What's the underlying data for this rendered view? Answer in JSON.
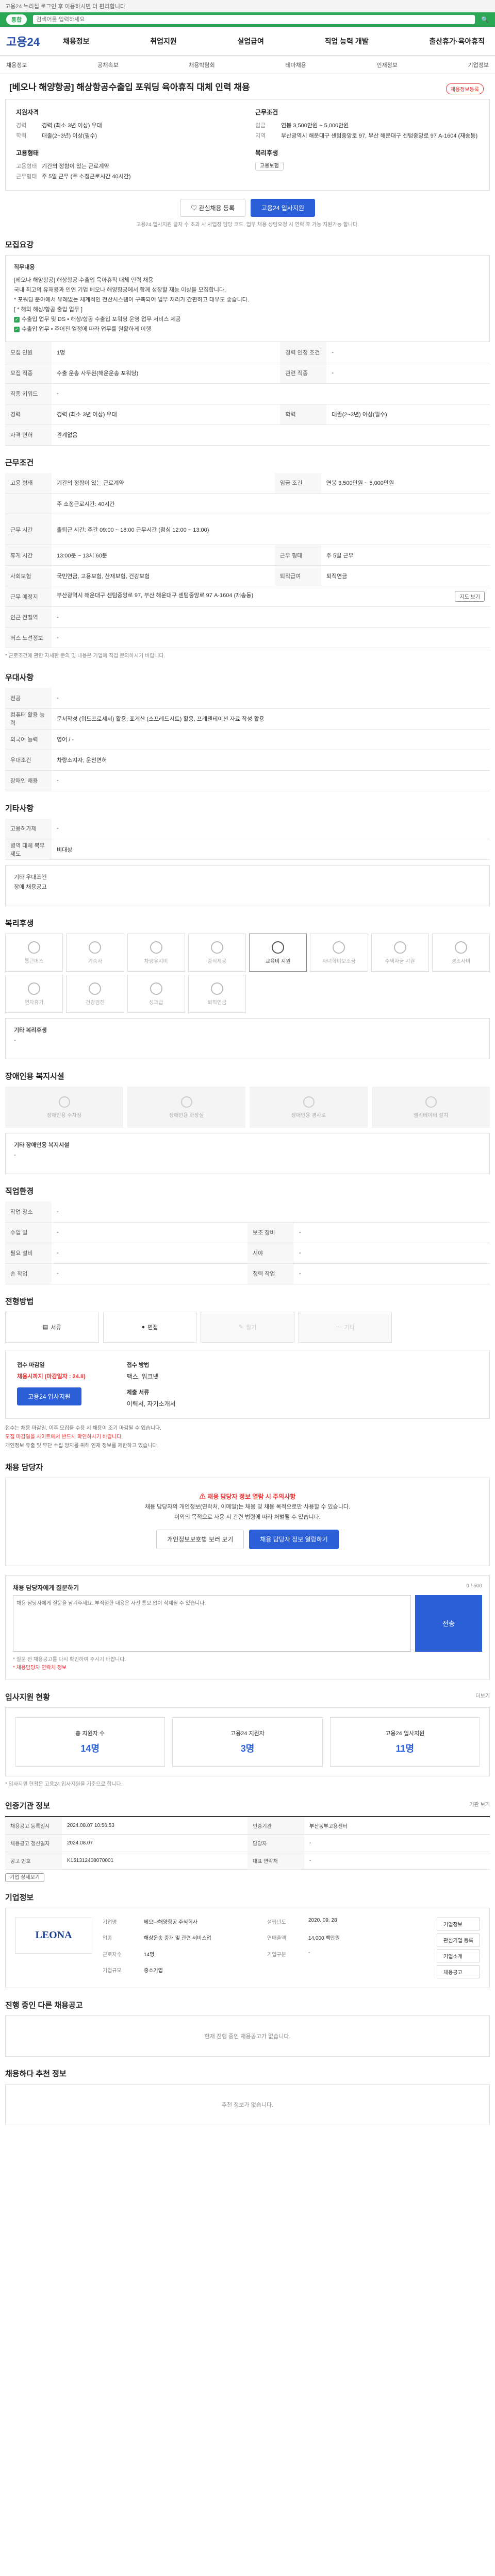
{
  "top": {
    "text": "고용24 누리집 로그인 후 이용하시면 더 편리합니다."
  },
  "search": {
    "pill": "통합",
    "placeholder": "검색어를 입력하세요"
  },
  "gnb": {
    "logo": "고용24",
    "menu": [
      "채용정보",
      "취업지원",
      "실업급여",
      "직업 능력 개발",
      "출산휴가·육아휴직"
    ]
  },
  "subnav": [
    "채용정보",
    "공채속보",
    "채용박람회",
    "테마채용",
    "인재정보",
    "기업정보"
  ],
  "job": {
    "title": "[베오나 해양항공] 해상항공수출입 포워딩 육아휴직 대체 인력 채용",
    "bookmark": "채용정보등록",
    "summary_left_title": "지원자격",
    "summary_right_title": "근무조건",
    "left": [
      {
        "k": "경력",
        "v": "경력 (최소 3년 이상) 우대"
      },
      {
        "k": "학력",
        "v": "대졸(2~3년) 이상(필수)"
      }
    ],
    "right": [
      {
        "k": "임금",
        "v": "연봉 3,500만원 ~ 5,000만원"
      },
      {
        "k": "지역",
        "v": "부산광역시 해운대구 센텀중앙로 97, 부산 해운대구 센텀중앙로 97 A-1604 (재송동)"
      }
    ],
    "type_title": "고용형태",
    "welfare_title": "복리후생",
    "type": [
      {
        "k": "고용형태",
        "v": "기간의 정함이 있는 근로계약"
      },
      {
        "k": "근무형태",
        "v": "주 5일 근무 (주 소정근로시간 40시간)"
      }
    ],
    "welfare_tag": "고용보험",
    "btn_save": "관심채용 등록",
    "btn_apply": "고용24 입사지원",
    "note": "고용24 입사지원 글자 수 초과 시 사업장 담당 코드. 업무 채용 상담요청 시 연락 후 가능 지원가능 합니다."
  },
  "s1": {
    "title": "모집요강",
    "duty_title": "직무내용",
    "duty": [
      "[베오나 해양항공] 해상항공 수출입 육아휴직 대체 인력 채용",
      "국내 최고의 유재용과 인연 기업 베오나 해양항공에서 함께 성장할 재능 이상을 모집합니다.",
      "* 포워딩 분야에서 유례없는 체계적인 전산시스템이 구축되어 업무 처리가 간편하고 대우도 좋습니다.",
      "[ * 해외 해상/항공 출입 업무 ]"
    ],
    "checks": [
      "수출입 업무 및 DS • 해상/항공 수출입 포워딩 운영 업무 서비스 제공",
      "수출입 업무 • 주어진 일정에 따라 업무를 원활하게 이행"
    ],
    "rows": [
      {
        "k": "모집 인원",
        "v": "1명",
        "k2": "경력 인정 조건",
        "v2": "-"
      },
      {
        "k": "모집 직종",
        "v": "수출 운송 사무원(해운운송 포워딩)",
        "k2": "관련 직종",
        "v2": "-"
      },
      {
        "k": "직종 키워드",
        "v": "-",
        "k2": "",
        "v2": ""
      },
      {
        "k": "경력",
        "v": "경력 (최소 3년 이상) 우대",
        "k2": "학력",
        "v2": "대졸(2~3년) 이상(필수)"
      },
      {
        "k": "자격 면허",
        "v": "관계없음",
        "k2": "",
        "v2": ""
      }
    ]
  },
  "s2": {
    "title": "근무조건",
    "rows": [
      {
        "k": "고용 형태",
        "v": "기간의 정함이 있는 근로계약",
        "k2": "임금 조건",
        "v2": "연봉 3,500만원 ~ 5,000만원"
      },
      {
        "k": "",
        "v": "주 소정근로시간: 40시간",
        "k2": "",
        "v2": ""
      },
      {
        "k": "근무 시간",
        "v": "출퇴근 시간: 주간 09:00 ~ 18:00 근무시간 (점심 12:00 ~ 13:00)",
        "k2": "",
        "v2": ""
      },
      {
        "k": "휴게 시간",
        "v": "13:00분 ~ 13시 60분",
        "k2": "근무 형태",
        "v2": "주 5일 근무"
      },
      {
        "k": "사회보험",
        "v": "국민연금, 고용보험, 산재보험, 건강보험",
        "k2": "퇴직급여",
        "v2": "퇴직연금"
      },
      {
        "k": "근무 예정지",
        "v": "부산광역시 해운대구 센텀중앙로 97, 부산 해운대구 센텀중앙로 97 A-1604 (재송동)",
        "k2": "",
        "v2": ""
      },
      {
        "k": "인근 전철역",
        "v": "-",
        "k2": "",
        "v2": ""
      },
      {
        "k": "버스 노선정보",
        "v": "-",
        "k2": "",
        "v2": ""
      }
    ],
    "map_btn": "지도 보기",
    "fine": "* 근로조건에 관한 자세한 문의 및 내용은 기업에 직접 문의하시기 바랍니다."
  },
  "s3": {
    "title": "우대사항",
    "rows": [
      {
        "k": "전공",
        "v": "-"
      },
      {
        "k": "컴퓨터 활용 능력",
        "v": "문서작성 (워드프로세서) 활용, 표계산 (스프레드시트) 활용, 프레젠테이션 자료 작성 활용"
      },
      {
        "k": "외국어 능력",
        "v": "영어 / -"
      },
      {
        "k": "우대조건",
        "v": "차량소지자, 운전면허"
      },
      {
        "k": "장애인 채용",
        "v": "-"
      }
    ]
  },
  "s4": {
    "title": "기타사항",
    "rows": [
      {
        "k": "고용허가제",
        "v": "-"
      },
      {
        "k": "병역 대체 복무 제도",
        "v": "비대상"
      }
    ],
    "link": "장애 채용공고",
    "sub": "기타 우대조건"
  },
  "s5": {
    "title": "복리후생",
    "items": [
      {
        "label": "통근버스",
        "on": false
      },
      {
        "label": "기숙사",
        "on": false
      },
      {
        "label": "차량유지비",
        "on": false
      },
      {
        "label": "중식제공",
        "on": false
      },
      {
        "label": "교육비 지원",
        "on": true
      },
      {
        "label": "자녀학비보조금",
        "on": false
      },
      {
        "label": "주택자금 지원",
        "on": false
      },
      {
        "label": "경조사비",
        "on": false
      },
      {
        "label": "연차휴가",
        "on": false
      },
      {
        "label": "건강검진",
        "on": false
      },
      {
        "label": "성과급",
        "on": false
      },
      {
        "label": "퇴직연금",
        "on": false
      }
    ],
    "sub": "기타 복리후생",
    "sub_value": "-"
  },
  "s6": {
    "title": "장애인용 복지시설",
    "items": [
      "장애인용 주차장",
      "장애인용 화장실",
      "장애인용 경사로",
      "엘리베이터 설치"
    ],
    "sub": "기타 장애인용 복지시설",
    "sub_value": "-"
  },
  "s7": {
    "title": "직업환경",
    "rows": [
      {
        "k": "작업 장소",
        "v": "-",
        "k2": "",
        "v2": ""
      },
      {
        "k": "수업 일",
        "v": "-",
        "k2": "보조 장비",
        "v2": "-"
      },
      {
        "k": "필요 설비",
        "v": "-",
        "k2": "시야",
        "v2": "-"
      },
      {
        "k": "손 작업",
        "v": "-",
        "k2": "청력 작업",
        "v2": "-"
      }
    ]
  },
  "s8": {
    "title": "전형방법",
    "methods": [
      "서류",
      "면접",
      "필기",
      "기타"
    ],
    "apply_title": "접수 마감일",
    "apply_date": "채용시까지 (마감일자 : 24.8)",
    "apply_btn": "고용24 입사지원",
    "method_title": "접수 방법",
    "method_value": "팩스, 워크넷",
    "doc_title": "제출 서류",
    "doc_value": "이력서, 자기소개서",
    "bullets": [
      "접수는 채용 마감일, 이후 모집을 수용 시 채용이 조기 마감될 수 있습니다.",
      "모집 마감일을 사이트에서 반드시 확인하시기 바랍니다.",
      "개인정보 유출 및 무단 수집 방지를 위해 인재 정보를 제한하고 있습니다."
    ]
  },
  "s9": {
    "title": "채용 담당자",
    "warn": "채용 담당자 정보 열람 시 주의사항",
    "lines": [
      "채용 담당자의 개인정보(연락처, 이메일)는 채용 및 채용 목적으로만 사용할 수 있습니다.",
      "이외의 목적으로 사용 시 관련 법령에 따라 처벌될 수 있습니다."
    ],
    "btn1": "개인정보보호법 보러 보기",
    "btn2": "채용 담당자 정보 열람하기"
  },
  "s10": {
    "title": "채용 담당자에게 질문하기",
    "count": "0 / 500",
    "placeholder": "채용 담당자에게 질문을 남겨주세요. 부적절한 내용은 사전 통보 없이 삭제될 수 있습니다.",
    "send": "전송",
    "notes": [
      "* 질문 전 채용공고를 다시 확인하여 주시기 바랍니다.",
      "* 채용담당자 연락처 정보"
    ]
  },
  "s11": {
    "title": "입사지원 현황",
    "more": "더보기",
    "stats": [
      {
        "label": "총 지원자 수",
        "n": "14명"
      },
      {
        "label": "고용24 지원자",
        "n": "3명"
      },
      {
        "label": "고용24 입사지원",
        "n": "11명"
      }
    ],
    "fine": "* 입사지원 현황은 고용24 입사지원을 기준으로 합니다."
  },
  "s12": {
    "title": "인증기관 정보",
    "rows": [
      {
        "k": "채용공고 등록일시",
        "v": "2024.08.07 10:56:53",
        "k2": "인증기관",
        "v2": "부산동부고용센터"
      },
      {
        "k": "채용공고 갱신일자",
        "v": "2024.08.07",
        "k2": "담당자",
        "v2": "-"
      },
      {
        "k": "공고 번호",
        "v": "K151312408070001",
        "k2": "대표 연락처",
        "v2": "-"
      }
    ],
    "btn1": "기업 상세보기",
    "btn2": "기관 보기"
  },
  "s13": {
    "title": "기업정보",
    "logo": "LEONA",
    "rows": [
      {
        "k": "기업명",
        "v": "베오나해양항공 주식회사",
        "k2": "설립년도",
        "v2": "2020. 09. 28"
      },
      {
        "k": "업종",
        "v": "해상운송 중개 및 관련 서비스업",
        "k2": "연매출액",
        "v2": "14,000 백만원"
      },
      {
        "k": "근로자수",
        "v": "14명",
        "k2": "기업구분",
        "v2": "-"
      },
      {
        "k": "기업규모",
        "v": "중소기업",
        "k2": "",
        "v2": ""
      }
    ],
    "btns": [
      "기업정보",
      "관심기업 등록",
      "기업소개",
      "채용공고"
    ]
  },
  "s14": {
    "title": "진행 중인 다른 채용공고",
    "more": "현재 진행 중인 채용공고가 없습니다."
  },
  "s15": {
    "title": "채용하다 추천 정보",
    "more": "추천 정보가 없습니다."
  }
}
